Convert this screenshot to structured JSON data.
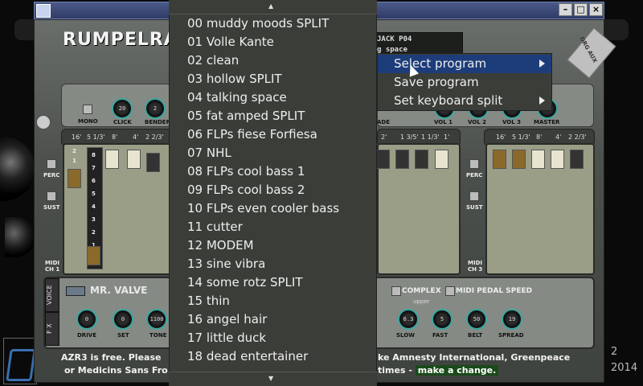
{
  "window": {
    "minimize": "–",
    "maximize": "□",
    "close": "×"
  },
  "synth": {
    "brand": "RUMPELRA",
    "lcd_line1": "JACK P04",
    "lcd_line2": "g space",
    "badge": "ORG AUX",
    "knobs": [
      {
        "label": "MONO",
        "value": ""
      },
      {
        "label": "CLICK",
        "value": "20"
      },
      {
        "label": "BENDER",
        "value": "2"
      },
      {
        "label": "ADE",
        "value": ""
      },
      {
        "label": "VOL 1",
        "value": ""
      },
      {
        "label": "VOL 2",
        "value": ""
      },
      {
        "label": "VOL 3",
        "value": ""
      },
      {
        "label": "MASTER",
        "value": ""
      }
    ],
    "footage_left": [
      "16'",
      "5 1/3'",
      "8'",
      "4'",
      "2 2/3'"
    ],
    "footage_mid": [
      "2'",
      "1 3/5'",
      "1 1/3'",
      "1'"
    ],
    "footage_right": [
      "16'",
      "5 1/3'",
      "8'",
      "4'",
      "2 2/3'"
    ],
    "side_labels": {
      "perc": "PERC",
      "sust": "SUST",
      "midi1a": "MIDI",
      "midi1b": "CH 1",
      "midi3a": "MIDI",
      "midi3b": "CH 3"
    },
    "drawbar_numbers": [
      "8",
      "7",
      "6",
      "5",
      "4",
      "3",
      "2",
      "1"
    ],
    "top_numbers": [
      "2",
      "1"
    ],
    "tabs": {
      "voice": "VOICE",
      "fx": "F X"
    },
    "valve_name": "MR. VALVE",
    "bottom_knobs": [
      {
        "label": "DRIVE",
        "value": "0"
      },
      {
        "label": "SET",
        "value": "0"
      },
      {
        "label": "TONE",
        "value": "1100"
      },
      {
        "label": "",
        "value": "0.3"
      },
      {
        "label": "SLOW",
        "value": ""
      },
      {
        "label": "FAST",
        "value": "5"
      },
      {
        "label": "BELT",
        "value": "50"
      },
      {
        "label": "SPREAD",
        "value": "19"
      }
    ],
    "complex": "COMPLEX",
    "midi_pedal_speed": "MIDI PEDAL SPEED",
    "upper": "upper",
    "footer_left1": "AZR3 is free. Please",
    "footer_left2": "or Medicins Sans Fro",
    "footer_right1": "ke Amnesty International, Greenpeace",
    "footer_right2_a": "times -",
    "footer_right2_b": "make a change."
  },
  "desktop": {
    "year": "2014",
    "year_top": "2"
  },
  "program_list": {
    "items": [
      "00 muddy moods SPLIT",
      "01 Volle Kante",
      "02 clean",
      "03 hollow SPLIT",
      "04 talking space",
      "05 fat amped SPLIT",
      "06 FLPs fiese Forfiesa",
      "07 NHL",
      "08 FLPs cool bass 1",
      "09 FLPs cool bass 2",
      "10 FLPs even cooler bass",
      "11 cutter",
      "12 MODEM",
      "13 sine vibra",
      "14 some rotz SPLIT",
      "15 thin",
      "16 angel hair",
      "17 little duck",
      "18 dead entertainer"
    ],
    "scroll_up": "▲",
    "scroll_down": "▼"
  },
  "context_menu": {
    "items": [
      {
        "label": "Select program",
        "submenu": true,
        "selected": true
      },
      {
        "label": "Save program",
        "submenu": false,
        "selected": false
      },
      {
        "label": "Set keyboard split",
        "submenu": true,
        "selected": false
      }
    ]
  }
}
